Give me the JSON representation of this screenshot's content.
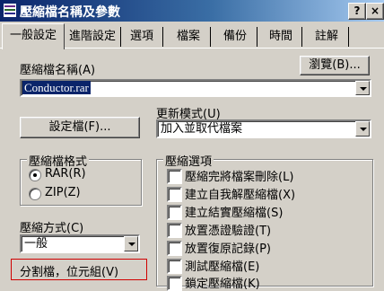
{
  "window": {
    "title": "壓縮檔名稱及參數",
    "help_button": "?",
    "close_button": "×"
  },
  "tabs": [
    "一般設定",
    "進階設定",
    "選項",
    "檔案",
    "備份",
    "時間",
    "註解"
  ],
  "archive_name": {
    "label": "壓縮檔名稱(A)",
    "value": "Conductor.rar",
    "browse_label": "瀏覽(B)..."
  },
  "update_mode": {
    "label": "更新模式(U)",
    "value": "加入並取代檔案"
  },
  "profiles_button": "設定檔(F)...",
  "archive_format": {
    "label": "壓縮檔格式",
    "options": [
      "RAR(R)",
      "ZIP(Z)"
    ],
    "selected": "RAR(R)"
  },
  "compression_method": {
    "label": "壓縮方式(C)",
    "value": "一般"
  },
  "split_volumes": {
    "label": "分割檔，位元組(V)"
  },
  "archive_options": {
    "label": "壓縮選項",
    "items": [
      "壓縮完將檔案刪除(L)",
      "建立自我解壓縮檔(X)",
      "建立結實壓縮檔(S)",
      "放置憑證驗證(T)",
      "放置復原記錄(P)",
      "測試壓縮檔(E)",
      "鎖定壓縮檔(K)"
    ]
  },
  "colors": {
    "title_bar_start": "#0a246a",
    "title_bar_end": "#a6caf0",
    "selection": "#0a246a",
    "face": "#d4d0c8",
    "highlight_box": "#d00000"
  }
}
